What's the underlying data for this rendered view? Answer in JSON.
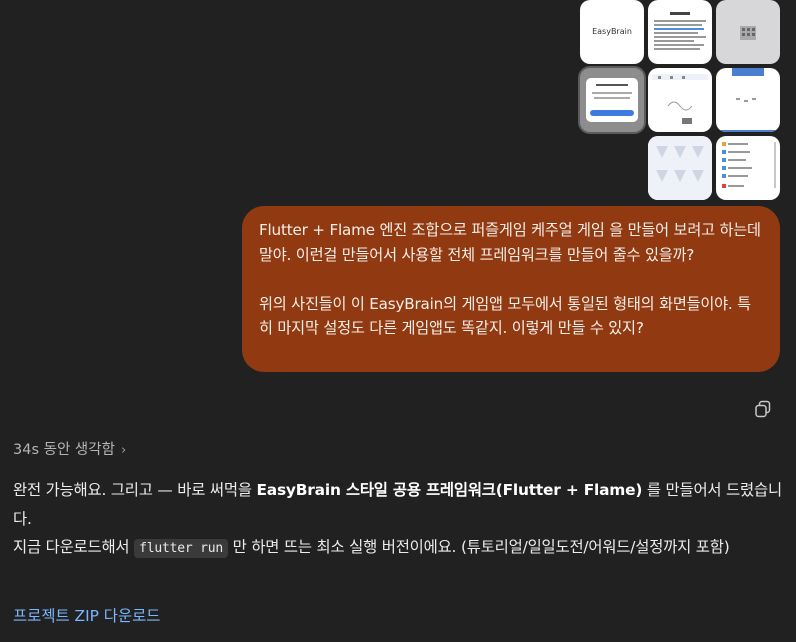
{
  "attachments": {
    "thumb1_logo": "EasyBrain"
  },
  "user_message": {
    "paragraph1": "Flutter + Flame 엔진 조합으로 퍼즐게임 케주얼 게임 을 만들어 보려고 하는데 말야. 이런걸 만들어서 사용할 전체 프레임워크를 만들어 줄수 있을까?",
    "paragraph2": "위의 사진들이 이 EasyBrain의 게임앱 모두에서 통일된 형태의 화면들이야. 특히 마지막 설정도 다른 게임앱도 똑같지. 이렇게 만들 수 있지?"
  },
  "thought_summary": {
    "label": "34s 동안 생각함",
    "chevron": "›"
  },
  "assistant": {
    "line1_a": "완전 가능해요. 그리고 — 바로 써먹을 ",
    "line1_bold": "EasyBrain 스타일 공용 프레임워크(Flutter + Flame)",
    "line1_b": " 를 만들어서 드렸습니다.",
    "line2_a": "지금 다운로드해서 ",
    "line2_code": "flutter run",
    "line2_b": " 만 하면 뜨는 최소 실행 버전이에요. (튜토리얼/일일도전/어워드/설정까지 포함)",
    "download_link": "프로젝트 ZIP 다운로드"
  },
  "colors": {
    "background": "#212121",
    "bubble": "#913a12",
    "link": "#7ab7ff"
  }
}
